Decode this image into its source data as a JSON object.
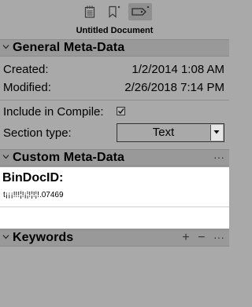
{
  "header": {
    "tabs": [
      {
        "name": "notes-tab",
        "icon": "notepad-icon",
        "active": false
      },
      {
        "name": "bookmarks-tab",
        "icon": "bookmark-icon",
        "active": false
      },
      {
        "name": "metadata-tab",
        "icon": "tag-icon",
        "active": true
      }
    ],
    "document_title": "Untitled Document"
  },
  "general": {
    "title": "General Meta-Data",
    "created_label": "Created:",
    "created_value": "1/2/2014 1:08 AM",
    "modified_label": "Modified:",
    "modified_value": "2/26/2018 7:14 PM",
    "include_label": "Include in Compile:",
    "include_checked": true,
    "section_type_label": "Section type:",
    "section_type_value": "Text"
  },
  "custom": {
    "title": "Custom Meta-Data",
    "more": "···",
    "field_label": "BinDocID:",
    "field_value": "t¡¡¡!!!¦!¡¦!¦!¦!.07469"
  },
  "keywords": {
    "title": "Keywords",
    "add": "+",
    "remove": "−",
    "more": "···"
  },
  "colors": {
    "panel_bg": "#a9a9a9",
    "header_bg": "#999999",
    "custom_bg": "#ffffff"
  }
}
